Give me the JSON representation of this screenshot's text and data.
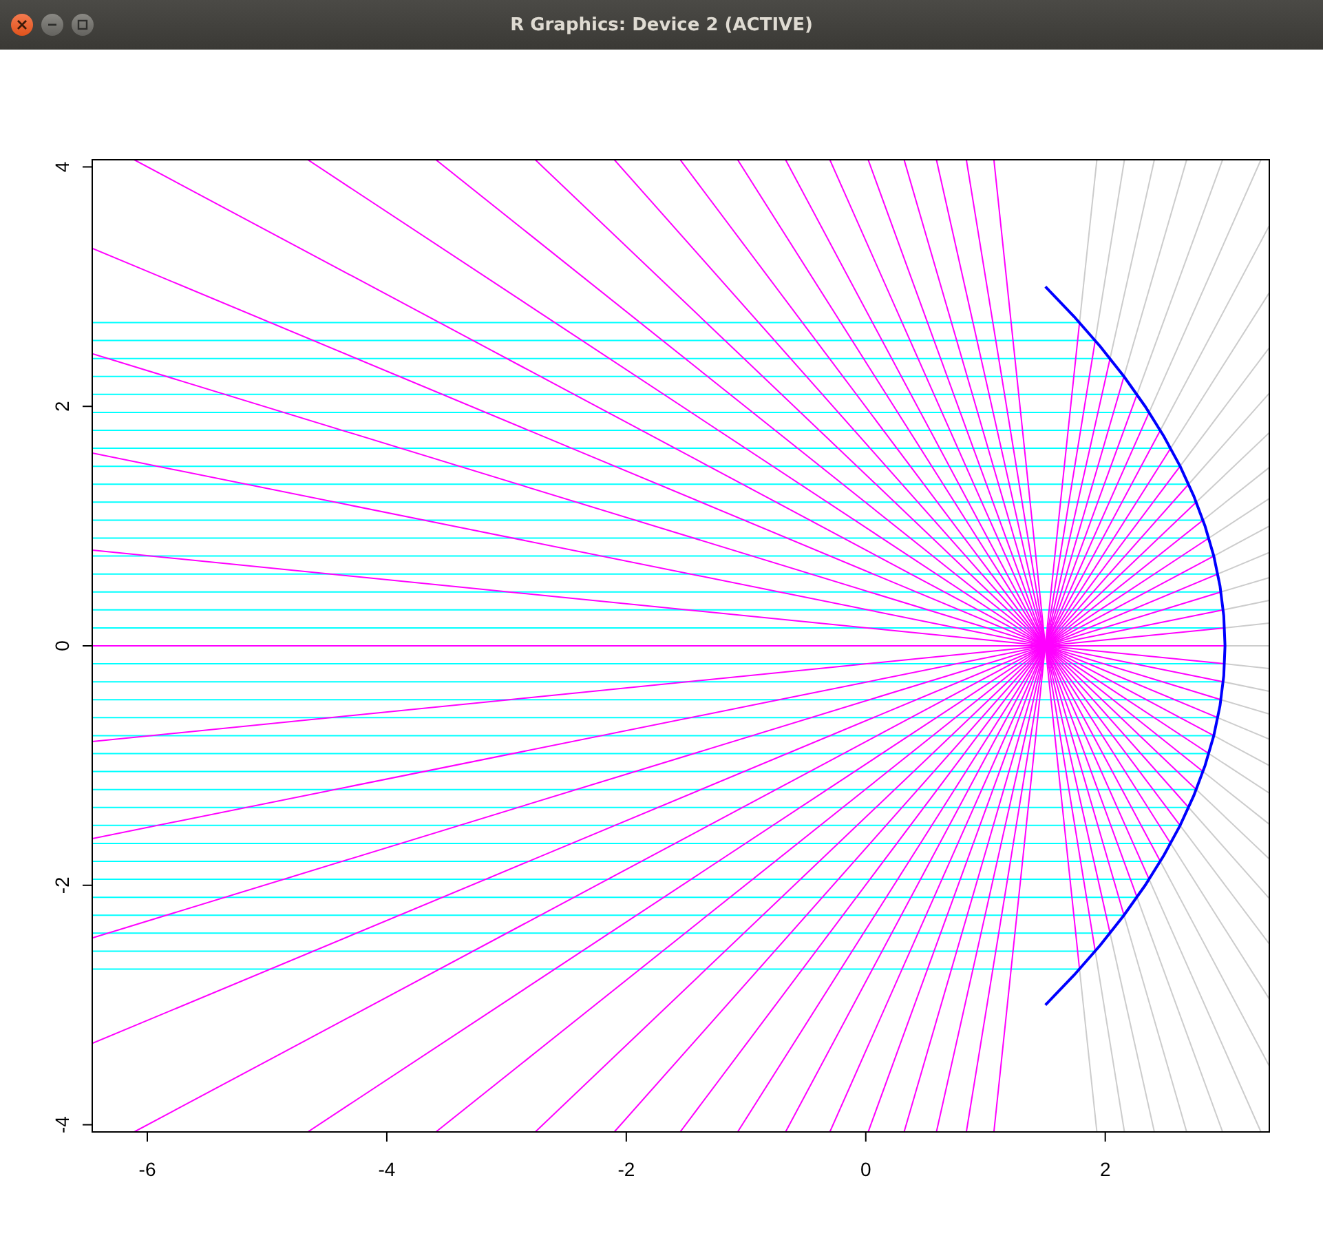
{
  "window": {
    "title": "R Graphics: Device 2 (ACTIVE)"
  },
  "plot": {
    "chart_data": {
      "type": "line",
      "xlim": [
        -6.46,
        3.37
      ],
      "ylim": [
        -4.06,
        4.06
      ],
      "xticks": [
        -6,
        -4,
        -2,
        0,
        2
      ],
      "yticks": [
        -4,
        -2,
        0,
        2,
        4
      ],
      "series": [
        {
          "color": "#00ffff",
          "x": [
            -6.46,
            1.785
          ],
          "values": [
            -2.7,
            -2.7
          ]
        },
        {
          "color": "#00ffff",
          "x": [
            -6.46,
            1.91625
          ],
          "values": [
            -2.55,
            -2.55
          ]
        },
        {
          "color": "#00ffff",
          "x": [
            -6.46,
            2.04
          ],
          "values": [
            -2.4,
            -2.4
          ]
        },
        {
          "color": "#00ffff",
          "x": [
            -6.46,
            2.15625
          ],
          "values": [
            -2.25,
            -2.25
          ]
        },
        {
          "color": "#00ffff",
          "x": [
            -6.46,
            2.265
          ],
          "values": [
            -2.1,
            -2.1
          ]
        },
        {
          "color": "#00ffff",
          "x": [
            -6.46,
            2.36625
          ],
          "values": [
            -1.95,
            -1.95
          ]
        },
        {
          "color": "#00ffff",
          "x": [
            -6.46,
            2.46
          ],
          "values": [
            -1.8,
            -1.8
          ]
        },
        {
          "color": "#00ffff",
          "x": [
            -6.46,
            2.54625
          ],
          "values": [
            -1.65,
            -1.65
          ]
        },
        {
          "color": "#00ffff",
          "x": [
            -6.46,
            2.625
          ],
          "values": [
            -1.5,
            -1.5
          ]
        },
        {
          "color": "#00ffff",
          "x": [
            -6.46,
            2.69625
          ],
          "values": [
            -1.35,
            -1.35
          ]
        },
        {
          "color": "#00ffff",
          "x": [
            -6.46,
            2.76
          ],
          "values": [
            -1.2,
            -1.2
          ]
        },
        {
          "color": "#00ffff",
          "x": [
            -6.46,
            2.81625
          ],
          "values": [
            -1.05,
            -1.05
          ]
        },
        {
          "color": "#00ffff",
          "x": [
            -6.46,
            2.865
          ],
          "values": [
            -0.9,
            -0.9
          ]
        },
        {
          "color": "#00ffff",
          "x": [
            -6.46,
            2.90625
          ],
          "values": [
            -0.75,
            -0.75
          ]
        },
        {
          "color": "#00ffff",
          "x": [
            -6.46,
            2.94
          ],
          "values": [
            -0.6,
            -0.6
          ]
        },
        {
          "color": "#00ffff",
          "x": [
            -6.46,
            2.96625
          ],
          "values": [
            -0.45,
            -0.45
          ]
        },
        {
          "color": "#00ffff",
          "x": [
            -6.46,
            2.985
          ],
          "values": [
            -0.3,
            -0.3
          ]
        },
        {
          "color": "#00ffff",
          "x": [
            -6.46,
            2.99625
          ],
          "values": [
            -0.15,
            -0.15
          ]
        },
        {
          "color": "#00ffff",
          "x": [
            -6.46,
            2.99625
          ],
          "values": [
            0.15,
            0.15
          ]
        },
        {
          "color": "#00ffff",
          "x": [
            -6.46,
            2.985
          ],
          "values": [
            0.3,
            0.3
          ]
        },
        {
          "color": "#00ffff",
          "x": [
            -6.46,
            2.96625
          ],
          "values": [
            0.45,
            0.45
          ]
        },
        {
          "color": "#00ffff",
          "x": [
            -6.46,
            2.94
          ],
          "values": [
            0.6,
            0.6
          ]
        },
        {
          "color": "#00ffff",
          "x": [
            -6.46,
            2.90625
          ],
          "values": [
            0.75,
            0.75
          ]
        },
        {
          "color": "#00ffff",
          "x": [
            -6.46,
            2.865
          ],
          "values": [
            0.9,
            0.9
          ]
        },
        {
          "color": "#00ffff",
          "x": [
            -6.46,
            2.81625
          ],
          "values": [
            1.05,
            1.05
          ]
        },
        {
          "color": "#00ffff",
          "x": [
            -6.46,
            2.76
          ],
          "values": [
            1.2,
            1.2
          ]
        },
        {
          "color": "#00ffff",
          "x": [
            -6.46,
            2.69625
          ],
          "values": [
            1.35,
            1.35
          ]
        },
        {
          "color": "#00ffff",
          "x": [
            -6.46,
            2.625
          ],
          "values": [
            1.5,
            1.5
          ]
        },
        {
          "color": "#00ffff",
          "x": [
            -6.46,
            2.54625
          ],
          "values": [
            1.65,
            1.65
          ]
        },
        {
          "color": "#00ffff",
          "x": [
            -6.46,
            2.46
          ],
          "values": [
            1.8,
            1.8
          ]
        },
        {
          "color": "#00ffff",
          "x": [
            -6.46,
            2.36625
          ],
          "values": [
            1.95,
            1.95
          ]
        },
        {
          "color": "#00ffff",
          "x": [
            -6.46,
            2.265
          ],
          "values": [
            2.1,
            2.1
          ]
        },
        {
          "color": "#00ffff",
          "x": [
            -6.46,
            2.15625
          ],
          "values": [
            2.25,
            2.25
          ]
        },
        {
          "color": "#00ffff",
          "x": [
            -6.46,
            2.04
          ],
          "values": [
            2.4,
            2.4
          ]
        },
        {
          "color": "#00ffff",
          "x": [
            -6.46,
            1.91625
          ],
          "values": [
            2.55,
            2.55
          ]
        },
        {
          "color": "#00ffff",
          "x": [
            -6.46,
            1.785
          ],
          "values": [
            2.7,
            2.7
          ]
        },
        {
          "color": "#ff00ff",
          "x": [
            1.785,
            1.07
          ],
          "values": [
            -2.7,
            4.06
          ]
        },
        {
          "color": "#ff00ff",
          "x": [
            1.91625,
            0.84
          ],
          "values": [
            -2.55,
            4.06
          ]
        },
        {
          "color": "#ff00ff",
          "x": [
            2.04,
            0.59
          ],
          "values": [
            -2.4,
            4.06
          ]
        },
        {
          "color": "#ff00ff",
          "x": [
            2.15625,
            0.32
          ],
          "values": [
            -2.25,
            4.06
          ]
        },
        {
          "color": "#ff00ff",
          "x": [
            2.265,
            0.02
          ],
          "values": [
            -2.1,
            4.06
          ]
        },
        {
          "color": "#ff00ff",
          "x": [
            2.36625,
            -0.3
          ],
          "values": [
            -1.95,
            4.06
          ]
        },
        {
          "color": "#ff00ff",
          "x": [
            2.46,
            -0.67
          ],
          "values": [
            -1.8,
            4.06
          ]
        },
        {
          "color": "#ff00ff",
          "x": [
            2.54625,
            -1.07
          ],
          "values": [
            -1.65,
            4.06
          ]
        },
        {
          "color": "#ff00ff",
          "x": [
            2.625,
            -1.55
          ],
          "values": [
            -1.5,
            4.06
          ]
        },
        {
          "color": "#ff00ff",
          "x": [
            2.69625,
            -2.1
          ],
          "values": [
            -1.35,
            4.06
          ]
        },
        {
          "color": "#ff00ff",
          "x": [
            2.76,
            -2.76
          ],
          "values": [
            -1.2,
            4.06
          ]
        },
        {
          "color": "#ff00ff",
          "x": [
            2.81625,
            -3.59
          ],
          "values": [
            -1.05,
            4.06
          ]
        },
        {
          "color": "#ff00ff",
          "x": [
            2.865,
            -4.66
          ],
          "values": [
            -0.9,
            4.06
          ]
        },
        {
          "color": "#ff00ff",
          "x": [
            2.90625,
            -6.11
          ],
          "values": [
            -0.75,
            4.06
          ]
        },
        {
          "color": "#ff00ff",
          "x": [
            2.94,
            -6.46
          ],
          "values": [
            -0.6,
            3.32
          ]
        },
        {
          "color": "#ff00ff",
          "x": [
            2.96625,
            -6.46
          ],
          "values": [
            -0.45,
            2.44
          ]
        },
        {
          "color": "#ff00ff",
          "x": [
            2.985,
            -6.46
          ],
          "values": [
            -0.3,
            1.61
          ]
        },
        {
          "color": "#ff00ff",
          "x": [
            2.99625,
            -6.46
          ],
          "values": [
            -0.15,
            0.8
          ]
        },
        {
          "color": "#ff00ff",
          "x": [
            3,
            -6.46
          ],
          "values": [
            0,
            0
          ]
        },
        {
          "color": "#ff00ff",
          "x": [
            2.99625,
            -6.46
          ],
          "values": [
            0.15,
            -0.8
          ]
        },
        {
          "color": "#ff00ff",
          "x": [
            2.985,
            -6.46
          ],
          "values": [
            0.3,
            -1.61
          ]
        },
        {
          "color": "#ff00ff",
          "x": [
            2.96625,
            -6.46
          ],
          "values": [
            0.45,
            -2.44
          ]
        },
        {
          "color": "#ff00ff",
          "x": [
            2.94,
            -6.46
          ],
          "values": [
            0.6,
            -3.32
          ]
        },
        {
          "color": "#ff00ff",
          "x": [
            2.90625,
            -6.11
          ],
          "values": [
            0.75,
            -4.06
          ]
        },
        {
          "color": "#ff00ff",
          "x": [
            2.865,
            -4.66
          ],
          "values": [
            0.9,
            -4.06
          ]
        },
        {
          "color": "#ff00ff",
          "x": [
            2.81625,
            -3.59
          ],
          "values": [
            1.05,
            -4.06
          ]
        },
        {
          "color": "#ff00ff",
          "x": [
            2.76,
            -2.76
          ],
          "values": [
            1.2,
            -4.06
          ]
        },
        {
          "color": "#ff00ff",
          "x": [
            2.69625,
            -2.1
          ],
          "values": [
            1.35,
            -4.06
          ]
        },
        {
          "color": "#ff00ff",
          "x": [
            2.625,
            -1.55
          ],
          "values": [
            1.5,
            -4.06
          ]
        },
        {
          "color": "#ff00ff",
          "x": [
            2.54625,
            -1.07
          ],
          "values": [
            1.65,
            -4.06
          ]
        },
        {
          "color": "#ff00ff",
          "x": [
            2.46,
            -0.67
          ],
          "values": [
            1.8,
            -4.06
          ]
        },
        {
          "color": "#ff00ff",
          "x": [
            2.36625,
            -0.3
          ],
          "values": [
            1.95,
            -4.06
          ]
        },
        {
          "color": "#ff00ff",
          "x": [
            2.265,
            0.02
          ],
          "values": [
            2.1,
            -4.06
          ]
        },
        {
          "color": "#ff00ff",
          "x": [
            2.15625,
            0.32
          ],
          "values": [
            2.25,
            -4.06
          ]
        },
        {
          "color": "#ff00ff",
          "x": [
            2.04,
            0.59
          ],
          "values": [
            2.4,
            -4.06
          ]
        },
        {
          "color": "#ff00ff",
          "x": [
            1.91625,
            0.84
          ],
          "values": [
            2.55,
            -4.06
          ]
        },
        {
          "color": "#ff00ff",
          "x": [
            1.785,
            1.07
          ],
          "values": [
            2.7,
            -4.06
          ]
        },
        {
          "color": "#cccccc",
          "x": [
            1.785,
            1.93
          ],
          "values": [
            -2.7,
            -4.06
          ]
        },
        {
          "color": "#cccccc",
          "x": [
            1.91625,
            2.16
          ],
          "values": [
            -2.55,
            -4.06
          ]
        },
        {
          "color": "#cccccc",
          "x": [
            2.04,
            2.41
          ],
          "values": [
            -2.4,
            -4.06
          ]
        },
        {
          "color": "#cccccc",
          "x": [
            2.15625,
            2.68
          ],
          "values": [
            -2.25,
            -4.06
          ]
        },
        {
          "color": "#cccccc",
          "x": [
            2.265,
            2.98
          ],
          "values": [
            -2.1,
            -4.06
          ]
        },
        {
          "color": "#cccccc",
          "x": [
            2.36625,
            3.3
          ],
          "values": [
            -1.95,
            -4.06
          ]
        },
        {
          "color": "#cccccc",
          "x": [
            2.46,
            3.37
          ],
          "values": [
            -1.8,
            -3.51
          ]
        },
        {
          "color": "#cccccc",
          "x": [
            2.54625,
            3.37
          ],
          "values": [
            -1.65,
            -2.95
          ]
        },
        {
          "color": "#cccccc",
          "x": [
            2.625,
            3.37
          ],
          "values": [
            -1.5,
            -2.49
          ]
        },
        {
          "color": "#cccccc",
          "x": [
            2.69625,
            3.37
          ],
          "values": [
            -1.35,
            -2.11
          ]
        },
        {
          "color": "#cccccc",
          "x": [
            2.76,
            3.37
          ],
          "values": [
            -1.2,
            -1.78
          ]
        },
        {
          "color": "#cccccc",
          "x": [
            2.81625,
            3.37
          ],
          "values": [
            -1.05,
            -1.49
          ]
        },
        {
          "color": "#cccccc",
          "x": [
            2.865,
            3.37
          ],
          "values": [
            -0.9,
            -1.23
          ]
        },
        {
          "color": "#cccccc",
          "x": [
            2.90625,
            3.37
          ],
          "values": [
            -0.75,
            -1
          ]
        },
        {
          "color": "#cccccc",
          "x": [
            2.94,
            3.37
          ],
          "values": [
            -0.6,
            -0.78
          ]
        },
        {
          "color": "#cccccc",
          "x": [
            2.96625,
            3.37
          ],
          "values": [
            -0.45,
            -0.57
          ]
        },
        {
          "color": "#cccccc",
          "x": [
            2.985,
            3.37
          ],
          "values": [
            -0.3,
            -0.38
          ]
        },
        {
          "color": "#cccccc",
          "x": [
            2.99625,
            3.37
          ],
          "values": [
            -0.15,
            -0.19
          ]
        },
        {
          "color": "#cccccc",
          "x": [
            3,
            3.37
          ],
          "values": [
            0,
            0
          ]
        },
        {
          "color": "#cccccc",
          "x": [
            2.99625,
            3.37
          ],
          "values": [
            0.15,
            0.19
          ]
        },
        {
          "color": "#cccccc",
          "x": [
            2.985,
            3.37
          ],
          "values": [
            0.3,
            0.38
          ]
        },
        {
          "color": "#cccccc",
          "x": [
            2.96625,
            3.37
          ],
          "values": [
            0.45,
            0.57
          ]
        },
        {
          "color": "#cccccc",
          "x": [
            2.94,
            3.37
          ],
          "values": [
            0.6,
            0.78
          ]
        },
        {
          "color": "#cccccc",
          "x": [
            2.90625,
            3.37
          ],
          "values": [
            0.75,
            1
          ]
        },
        {
          "color": "#cccccc",
          "x": [
            2.865,
            3.37
          ],
          "values": [
            0.9,
            1.23
          ]
        },
        {
          "color": "#cccccc",
          "x": [
            2.81625,
            3.37
          ],
          "values": [
            1.05,
            1.49
          ]
        },
        {
          "color": "#cccccc",
          "x": [
            2.76,
            3.37
          ],
          "values": [
            1.2,
            1.78
          ]
        },
        {
          "color": "#cccccc",
          "x": [
            2.69625,
            3.37
          ],
          "values": [
            1.35,
            2.11
          ]
        },
        {
          "color": "#cccccc",
          "x": [
            2.625,
            3.37
          ],
          "values": [
            1.5,
            2.49
          ]
        },
        {
          "color": "#cccccc",
          "x": [
            2.54625,
            3.37
          ],
          "values": [
            1.65,
            2.95
          ]
        },
        {
          "color": "#cccccc",
          "x": [
            2.46,
            3.37
          ],
          "values": [
            1.8,
            3.51
          ]
        },
        {
          "color": "#cccccc",
          "x": [
            2.36625,
            3.3
          ],
          "values": [
            1.95,
            4.06
          ]
        },
        {
          "color": "#cccccc",
          "x": [
            2.265,
            2.98
          ],
          "values": [
            2.1,
            4.06
          ]
        },
        {
          "color": "#cccccc",
          "x": [
            2.15625,
            2.68
          ],
          "values": [
            2.25,
            4.06
          ]
        },
        {
          "color": "#cccccc",
          "x": [
            2.04,
            2.41
          ],
          "values": [
            2.4,
            4.06
          ]
        },
        {
          "color": "#cccccc",
          "x": [
            1.91625,
            2.16
          ],
          "values": [
            2.55,
            4.06
          ]
        },
        {
          "color": "#cccccc",
          "x": [
            1.785,
            1.93
          ],
          "values": [
            2.7,
            4.06
          ]
        },
        {
          "color": "#0000ff",
          "x": [
            1.5,
            1.7396,
            1.9583,
            2.1563,
            2.3333,
            2.4896,
            2.625,
            2.7396,
            2.8333,
            2.9063,
            2.9583,
            2.9896,
            3,
            2.9896,
            2.9583,
            2.9063,
            2.8333,
            2.7396,
            2.625,
            2.4896,
            2.3333,
            2.1563,
            1.9583,
            1.7396,
            1.5
          ],
          "values": [
            -3,
            -2.75,
            -2.5,
            -2.25,
            -2,
            -1.75,
            -1.5,
            -1.25,
            -1,
            -0.75,
            -0.5,
            -0.25,
            0,
            0.25,
            0.5,
            0.75,
            1,
            1.25,
            1.5,
            1.75,
            2,
            2.25,
            2.5,
            2.75,
            3
          ]
        }
      ]
    }
  }
}
